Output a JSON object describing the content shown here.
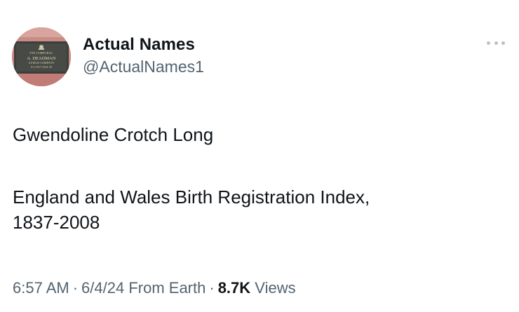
{
  "author": {
    "display_name": "Actual Names",
    "handle": "@ActualNames1",
    "avatar": {
      "line1": "PTE CORPORAL",
      "line2": "A. DEADMAN",
      "line3": "A FIELD COMPANY",
      "line4": "9-2-1917 AGE 20"
    }
  },
  "more_icon": "more-horizontal-icon",
  "tweet": {
    "line1": "Gwendoline Crotch Long",
    "line2": "England and Wales Birth Registration Index,",
    "line3": "1837-2008"
  },
  "meta": {
    "time": "6:57 AM",
    "dot": "·",
    "date_source": "6/4/24 From Earth",
    "views_count": "8.7K",
    "views_label": "Views"
  },
  "colors": {
    "text_primary": "#0f1419",
    "text_secondary": "#536471"
  }
}
